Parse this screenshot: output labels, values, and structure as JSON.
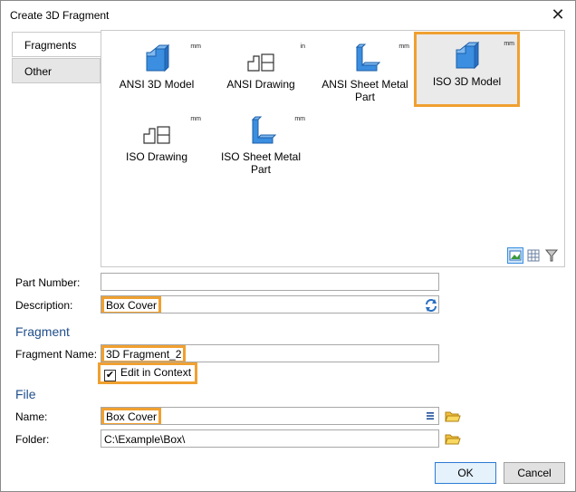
{
  "window": {
    "title": "Create 3D Fragment",
    "close_glyph": "✕"
  },
  "tabs": [
    {
      "label": "Fragments",
      "active": true
    },
    {
      "label": "Other",
      "active": false
    }
  ],
  "templates": [
    {
      "label": "ANSI 3D Model",
      "unit": "mm",
      "icon": "block-3d-icon",
      "selected": false
    },
    {
      "label": "ANSI Drawing",
      "unit": "in",
      "icon": "drawing-sheets-icon",
      "selected": false
    },
    {
      "label": "ANSI Sheet Metal Part",
      "unit": "mm",
      "icon": "sheet-metal-icon",
      "selected": false
    },
    {
      "label": "ISO 3D Model",
      "unit": "mm",
      "icon": "block-3d-icon",
      "selected": true
    },
    {
      "label": "ISO Drawing",
      "unit": "mm",
      "icon": "drawing-sheets-icon",
      "selected": false
    },
    {
      "label": "ISO Sheet Metal Part",
      "unit": "mm",
      "icon": "sheet-metal-icon",
      "selected": false
    }
  ],
  "view_buttons": [
    "thumbnail-view-icon",
    "grid-view-icon",
    "filter-icon"
  ],
  "part_number": {
    "label": "Part Number:",
    "value": ""
  },
  "description": {
    "label": "Description:",
    "value": "Box Cover"
  },
  "fragment_section": {
    "title": "Fragment"
  },
  "fragment_name": {
    "label": "Fragment Name:",
    "value": "3D Fragment_2"
  },
  "edit_in_context": {
    "label": "Edit in Context",
    "checked": true,
    "glyph": "✔"
  },
  "file_section": {
    "title": "File"
  },
  "file_name": {
    "label": "Name:",
    "value": "Box Cover"
  },
  "folder": {
    "label": "Folder:",
    "value": "C:\\Example\\Box\\"
  },
  "buttons": {
    "ok": "OK",
    "cancel": "Cancel"
  },
  "colors": {
    "highlight": "#f0a030",
    "section_title": "#1f4e8c",
    "icon_blue": "#3b8ee0"
  }
}
